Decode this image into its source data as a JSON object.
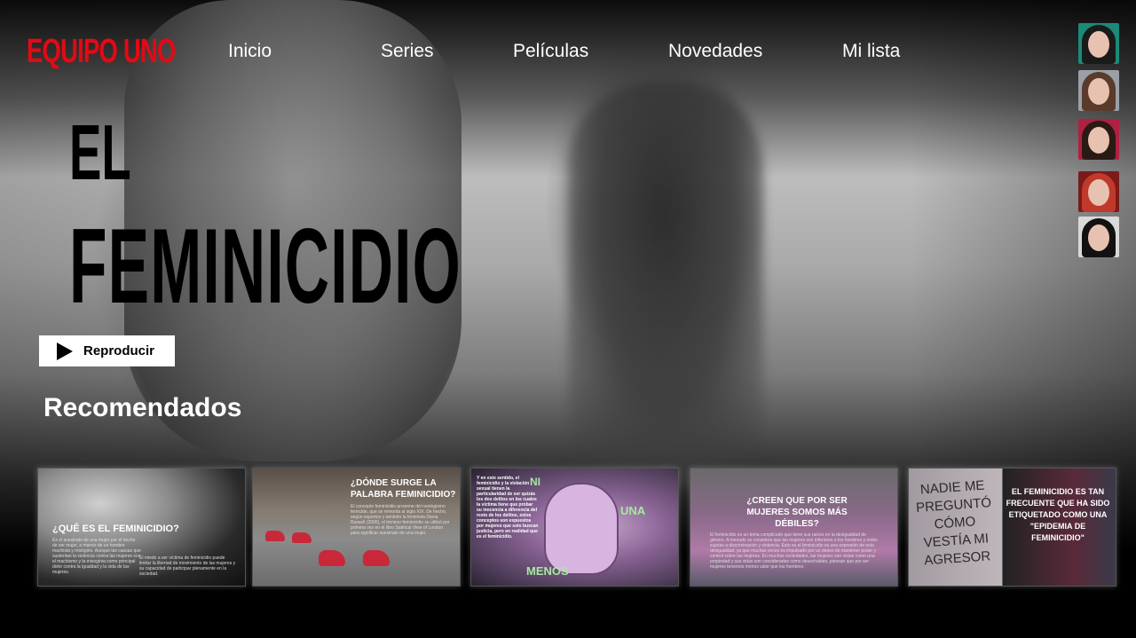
{
  "brand": {
    "logo": "EQUIPO UNO",
    "color": "#e50914"
  },
  "nav": {
    "items": [
      {
        "label": "Inicio"
      },
      {
        "label": "Series"
      },
      {
        "label": "Películas"
      },
      {
        "label": "Novedades"
      },
      {
        "label": "Mi lista"
      }
    ]
  },
  "profiles": [
    {
      "name": "profile-1",
      "hair": "#1a1a1a",
      "bg": "#1c8a78"
    },
    {
      "name": "profile-2",
      "hair": "#5a3a2a",
      "bg": "#9aa0a8"
    },
    {
      "name": "profile-3",
      "hair": "#2a1a14",
      "bg": "#b02040"
    },
    {
      "name": "profile-4",
      "hair": "#c0392b",
      "bg": "#7a1a1a"
    },
    {
      "name": "profile-5",
      "hair": "#111111",
      "bg": "#d9d9d9"
    }
  ],
  "hero": {
    "title_line1": "EL",
    "title_line2": "FEMINICIDIO",
    "play_label": "Reproducir"
  },
  "section": {
    "title": "Recomendados"
  },
  "cards": [
    {
      "title": "¿QUÉ ES EL FEMINICIDIO?",
      "text1": "Es el asesinato de una mujer por el hecho de ser mujer, a manos de un hombre machista y misógino. Aunque las causas que sustentan la violencia contra las mujeres son el machismo y la misoginia como principal dolor contra la igualdad y la vida de las mujeres.",
      "text2": "El miedo a ser víctima de feminicidio puede limitar la libertad de movimiento de las mujeres y su capacidad de participar plenamente en la sociedad."
    },
    {
      "title": "¿DÓNDE SURGE LA PALABRA FEMINICIDIO?",
      "text1": "El concepto feminicidio proviene del neologismo femicide, que se remonta al siglo XIX. De hecho, según expertos y también la feminista Diana Russell (2006), el término feminicidio se utilizó por primera vez en el libro Satirical View of London para significar asesinato de una mujer."
    },
    {
      "title": "",
      "text1": "Y en este sentido, el feminicidio y la violación sexual tienen la particularidad de ser quizás los dos delitos en los cuales la víctima tiene que probar su inocencia a diferencia del resto de los delitos, estos conceptos son expuestos por mujeres que solo buscan justicia, pero en realidad que es el feminicidio.",
      "art1": "NI",
      "art2": "UNA",
      "art3": "MENOS"
    },
    {
      "title": "¿CREEN QUE POR SER MUJERES SOMOS MÁS DÉBILES?",
      "text1": "El feminicidio es un tema complicado que tiene sus raíces en la desigualdad de género. A menudo se considera que las mujeres son inferiores a los hombres y están sujetas a discriminación y violencia. Esto es el feminicidio es una expresión de esta desigualdad, ya que muchas veces es impulsado por un deseo de mantener poder y control sobre las mujeres. En muchas sociedades, las mujeres son vistas como una propiedad y sus vidas son consideradas como desechables, piensan que por ser mujeres tenemos menos valor que los hombres"
    },
    {
      "title": "EL FEMINICIDIO ES TAN FRECUENTE QUE HA SIDO ETIQUETADO COMO UNA \"EPIDEMIA DE FEMINICIDIO\"",
      "art1": "NADIE ME PREGUNTÓ CÓMO VESTÍA MI AGRESOR"
    }
  ]
}
